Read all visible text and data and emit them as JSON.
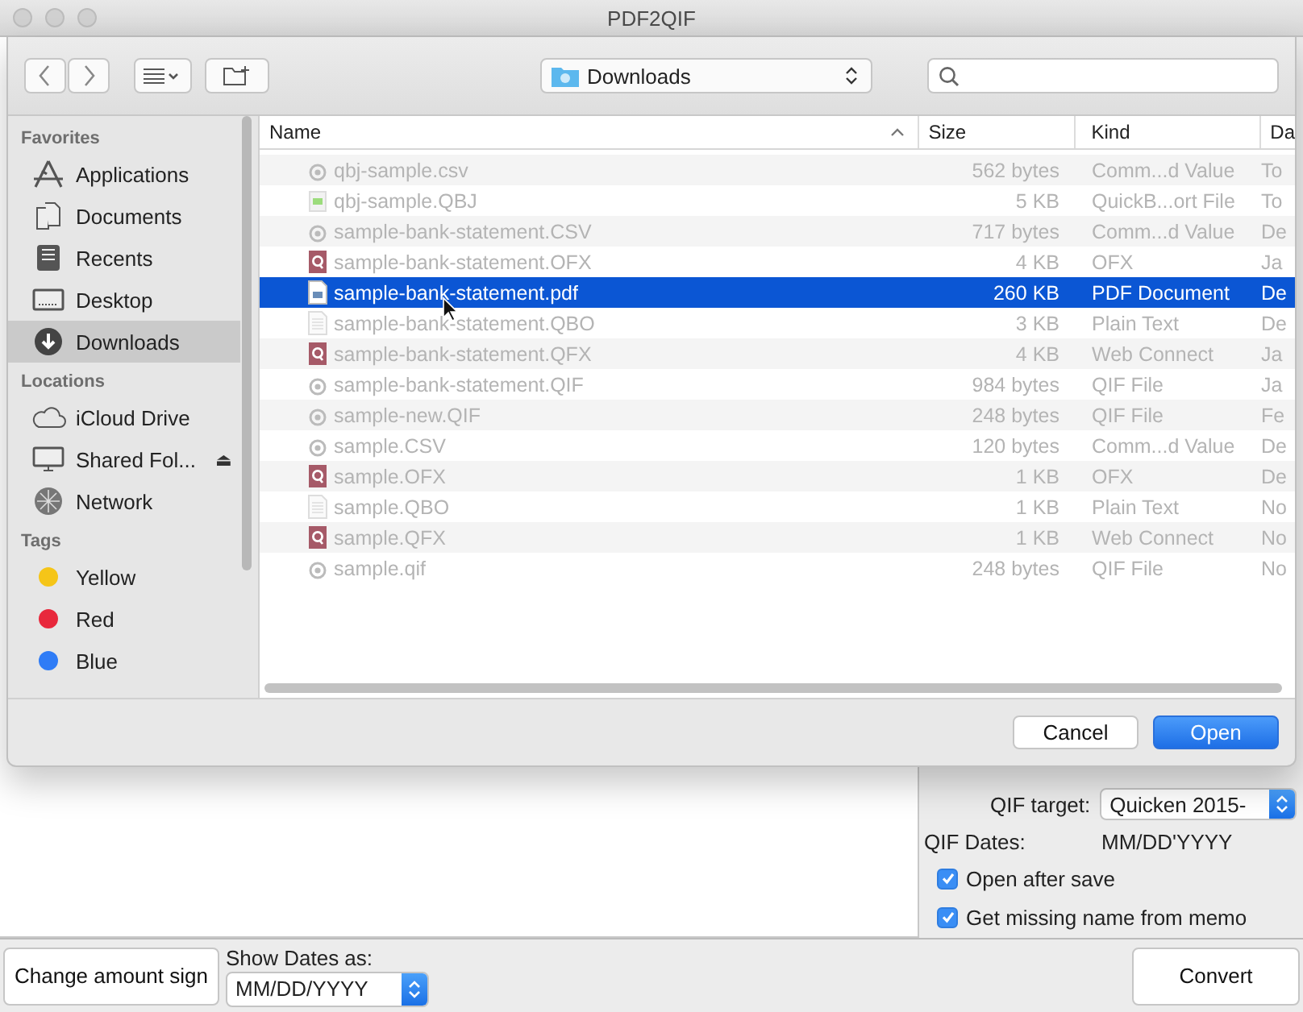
{
  "window": {
    "title": "PDF2QIF"
  },
  "dialog": {
    "location": "Downloads",
    "sidebar": [
      {
        "heading": "Favorites",
        "items": [
          {
            "label": "Applications",
            "kind": "apps",
            "selected": false
          },
          {
            "label": "Documents",
            "kind": "docs",
            "selected": false
          },
          {
            "label": "Recents",
            "kind": "recents",
            "selected": false
          },
          {
            "label": "Desktop",
            "kind": "desktop",
            "selected": false
          },
          {
            "label": "Downloads",
            "kind": "downloads",
            "selected": true
          }
        ]
      },
      {
        "heading": "Locations",
        "items": [
          {
            "label": "iCloud Drive",
            "kind": "cloud",
            "selected": false
          },
          {
            "label": "Shared Fol...",
            "kind": "shared",
            "selected": false,
            "eject": "⏏"
          },
          {
            "label": "Network",
            "kind": "network",
            "selected": false
          }
        ]
      },
      {
        "heading": "Tags",
        "items": [
          {
            "label": "Yellow",
            "kind": "tag",
            "color": "#f5c518",
            "selected": false
          },
          {
            "label": "Red",
            "kind": "tag",
            "color": "#e8283c",
            "selected": false
          },
          {
            "label": "Blue",
            "kind": "tag",
            "color": "#2f7cf6",
            "selected": false
          }
        ]
      }
    ],
    "columns": [
      "Name",
      "Size",
      "Kind",
      "Da"
    ],
    "files": [
      {
        "name": "qbj-sample.csv",
        "size": "562 bytes",
        "file_type": "Comm...d Value",
        "date": "To",
        "kind": "csv",
        "disabled": true,
        "selected": false
      },
      {
        "name": "qbj-sample.QBJ",
        "size": "5 KB",
        "file_type": "QuickB...ort File",
        "date": "To",
        "kind": "qbj",
        "disabled": true,
        "selected": false
      },
      {
        "name": "sample-bank-statement.CSV",
        "size": "717 bytes",
        "file_type": "Comm...d Value",
        "date": "De",
        "kind": "csv",
        "disabled": true,
        "selected": false
      },
      {
        "name": "sample-bank-statement.OFX",
        "size": "4 KB",
        "file_type": "OFX",
        "date": "Ja",
        "kind": "q",
        "disabled": true,
        "selected": false
      },
      {
        "name": "sample-bank-statement.pdf",
        "size": "260 KB",
        "file_type": "PDF Document",
        "date": "De",
        "kind": "pdf",
        "disabled": false,
        "selected": true
      },
      {
        "name": "sample-bank-statement.QBO",
        "size": "3 KB",
        "file_type": "Plain Text",
        "date": "De",
        "kind": "text",
        "disabled": true,
        "selected": false
      },
      {
        "name": "sample-bank-statement.QFX",
        "size": "4 KB",
        "file_type": "Web Connect",
        "date": "Ja",
        "kind": "q",
        "disabled": true,
        "selected": false
      },
      {
        "name": "sample-bank-statement.QIF",
        "size": "984 bytes",
        "file_type": "QIF File",
        "date": "Ja",
        "kind": "csv",
        "disabled": true,
        "selected": false
      },
      {
        "name": "sample-new.QIF",
        "size": "248 bytes",
        "file_type": "QIF File",
        "date": "Fe",
        "kind": "csv",
        "disabled": true,
        "selected": false
      },
      {
        "name": "sample.CSV",
        "size": "120 bytes",
        "file_type": "Comm...d Value",
        "date": "De",
        "kind": "csv",
        "disabled": true,
        "selected": false
      },
      {
        "name": "sample.OFX",
        "size": "1 KB",
        "file_type": "OFX",
        "date": "De",
        "kind": "q",
        "disabled": true,
        "selected": false
      },
      {
        "name": "sample.QBO",
        "size": "1 KB",
        "file_type": "Plain Text",
        "date": "No",
        "kind": "text",
        "disabled": true,
        "selected": false
      },
      {
        "name": "sample.QFX",
        "size": "1 KB",
        "file_type": "Web Connect",
        "date": "No",
        "kind": "q",
        "disabled": true,
        "selected": false
      },
      {
        "name": "sample.qif",
        "size": "248 bytes",
        "file_type": "QIF File",
        "date": "No",
        "kind": "csv",
        "disabled": true,
        "selected": false
      }
    ],
    "buttons": [
      {
        "label": "Cancel",
        "default": false
      },
      {
        "label": "Open",
        "default": true
      }
    ]
  },
  "options": {
    "qif_target_label": "QIF target:",
    "qif_target": "Quicken 2015-",
    "qif_dates_label": "QIF Dates:",
    "qif_dates": "MM/DD'YYYY",
    "checkboxes": [
      {
        "label": "Open after save",
        "checked": true
      },
      {
        "label": "Get missing name from memo",
        "checked": true
      }
    ],
    "convert": "Convert"
  },
  "bottom": {
    "change_sign": "Change amount sign",
    "show_dates_label": "Show Dates as:",
    "show_dates": "MM/DD/YYYY"
  }
}
